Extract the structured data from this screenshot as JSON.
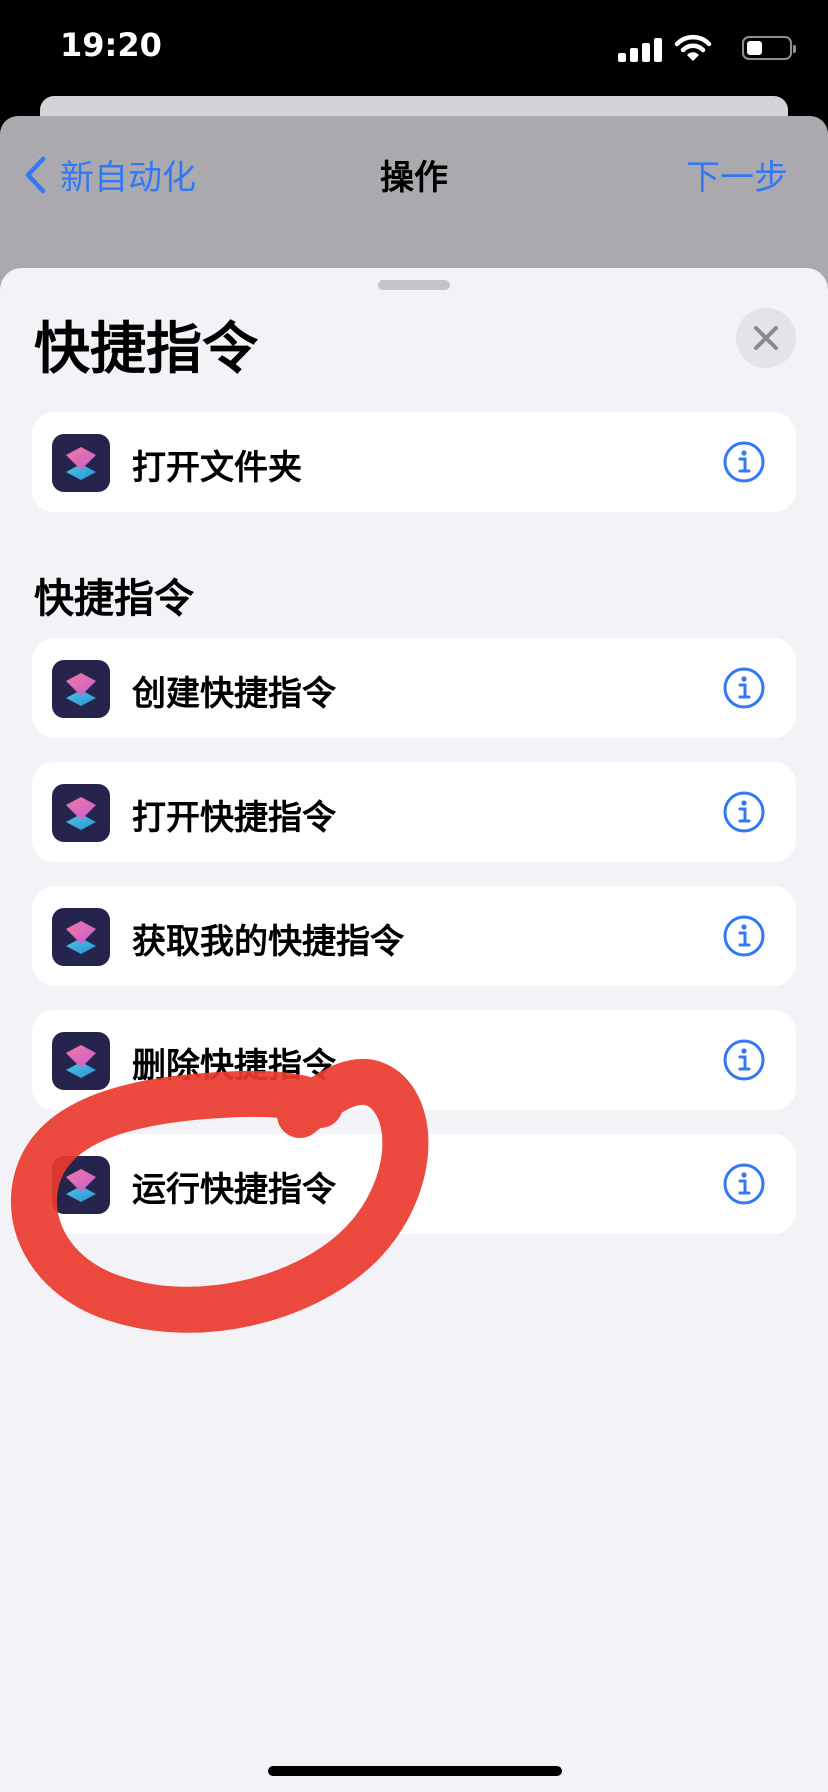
{
  "status_bar": {
    "time": "19:20",
    "battery_level": 0.35
  },
  "nav": {
    "back_label": "新自动化",
    "title": "操作",
    "next_label": "下一步"
  },
  "sheet": {
    "title": "快捷指令",
    "top_item": {
      "label": "打开文件夹",
      "icon": "shortcuts-app-icon"
    },
    "section_title": "快捷指令",
    "items": [
      {
        "label": "创建快捷指令",
        "icon": "shortcuts-app-icon"
      },
      {
        "label": "打开快捷指令",
        "icon": "shortcuts-app-icon"
      },
      {
        "label": "获取我的快捷指令",
        "icon": "shortcuts-app-icon"
      },
      {
        "label": "删除快捷指令",
        "icon": "shortcuts-app-icon"
      },
      {
        "label": "运行快捷指令",
        "icon": "shortcuts-app-icon"
      }
    ]
  },
  "colors": {
    "accent": "#3478f6",
    "annotation": "#ea3b2e",
    "sheet_bg": "#f2f2f7"
  }
}
